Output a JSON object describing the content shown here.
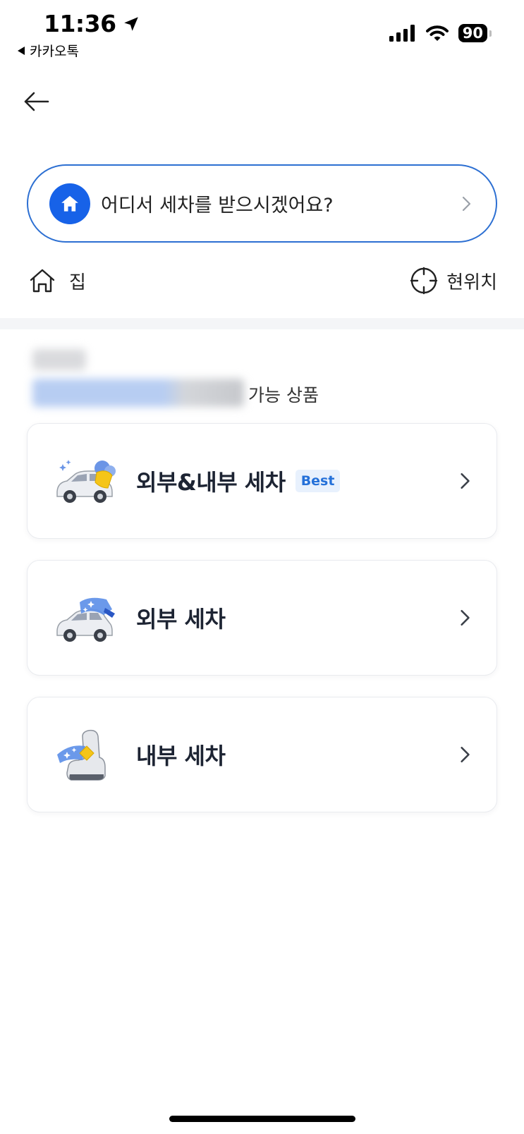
{
  "status_bar": {
    "time": "11:36",
    "back_app": "카카오톡",
    "battery": "90"
  },
  "header": {
    "back_icon": "arrow-left-icon"
  },
  "search": {
    "placeholder": "어디서 세차를 받으시겠어요?",
    "icon": "home-icon"
  },
  "quick_locations": {
    "home_label": "집",
    "current_label": "현위치"
  },
  "address": {
    "available_suffix": "가능 상품"
  },
  "products": [
    {
      "title": "외부&내부 세차",
      "badge": "Best",
      "icon": "car-wash-full-icon"
    },
    {
      "title": "외부 세차",
      "icon": "car-exterior-icon"
    },
    {
      "title": "내부 세차",
      "icon": "car-seat-icon"
    }
  ],
  "colors": {
    "accent": "#1762e8",
    "border_accent": "#2c6fd2",
    "badge_bg": "#e8f1fd",
    "badge_text": "#2571d9"
  }
}
